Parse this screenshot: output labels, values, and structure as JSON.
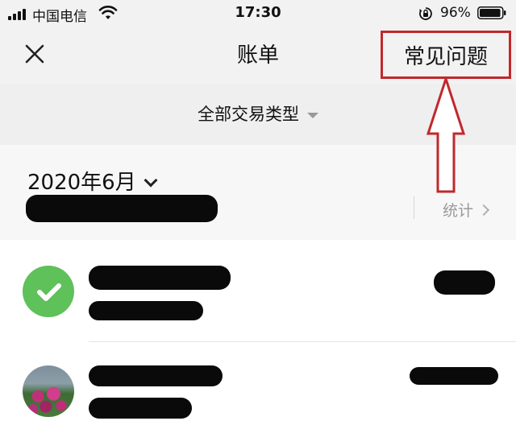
{
  "status_bar": {
    "carrier": "中国电信",
    "time": "17:30",
    "battery_percent": "96%",
    "battery_level": 0.96,
    "icons": [
      "signal-icon",
      "wifi-icon",
      "rotation-lock-icon",
      "battery-icon"
    ]
  },
  "nav": {
    "title": "账单",
    "faq_label": "常见问题",
    "close_icon": "close-icon"
  },
  "filter": {
    "label": "全部交易类型"
  },
  "month": {
    "label": "2020年6月",
    "stats_label": "统计"
  },
  "transactions": [
    {
      "icon": "wechat-pay-icon"
    },
    {
      "icon": "avatar-flowers"
    }
  ],
  "colors": {
    "annotation": "#c1282c",
    "wechat_green": "#5ec15a",
    "nav_background": "#f2f2f2",
    "muted_text": "#9a9a9a"
  }
}
